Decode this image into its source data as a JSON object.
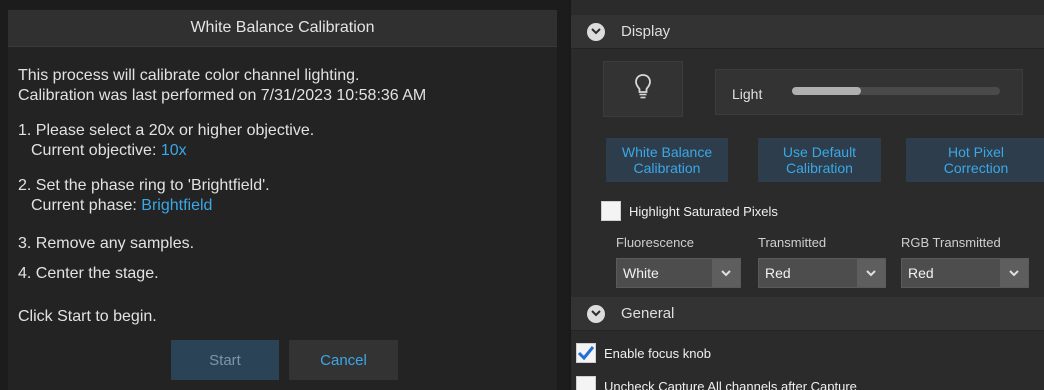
{
  "dialog": {
    "title": "White Balance Calibration",
    "intro_line1": "This process will calibrate color channel lighting.",
    "intro_line2": "Calibration was last performed on 7/31/2023 10:58:36 AM",
    "step1": "1. Please select a 20x or higher objective.",
    "step1_detail_label": "Current objective: ",
    "step1_detail_value": "10x",
    "step2": "2. Set the phase ring to 'Brightfield'.",
    "step2_detail_label": "Current phase: ",
    "step2_detail_value": "Brightfield",
    "step3": "3. Remove any samples.",
    "step4": "4. Center the stage.",
    "prompt": "Click Start to begin.",
    "start_label": "Start",
    "cancel_label": "Cancel"
  },
  "panel": {
    "display_section": {
      "title": "Display",
      "expanded": true
    },
    "light": {
      "label": "Light",
      "level": 0.33,
      "icon": "lightbulb-icon"
    },
    "buttons": {
      "white_balance": "White Balance\nCalibration",
      "use_default": "Use Default\nCalibration",
      "hot_pixel": "Hot Pixel\nCorrection"
    },
    "highlight_saturated": {
      "label": "Highlight Saturated Pixels",
      "checked": false
    },
    "dropdowns": [
      {
        "label": "Fluorescence",
        "value": "White"
      },
      {
        "label": "Transmitted",
        "value": "Red"
      },
      {
        "label": "RGB Transmitted",
        "value": "Red"
      }
    ],
    "general_section": {
      "title": "General",
      "expanded": true
    },
    "enable_focus_knob": {
      "label": "Enable focus knob",
      "checked": true
    },
    "uncheck_capture": {
      "label": "Uncheck Capture All channels after Capture",
      "checked": false
    }
  },
  "colors": {
    "accent": "#3aa8e8",
    "checkmark": "#1e6fd9"
  }
}
